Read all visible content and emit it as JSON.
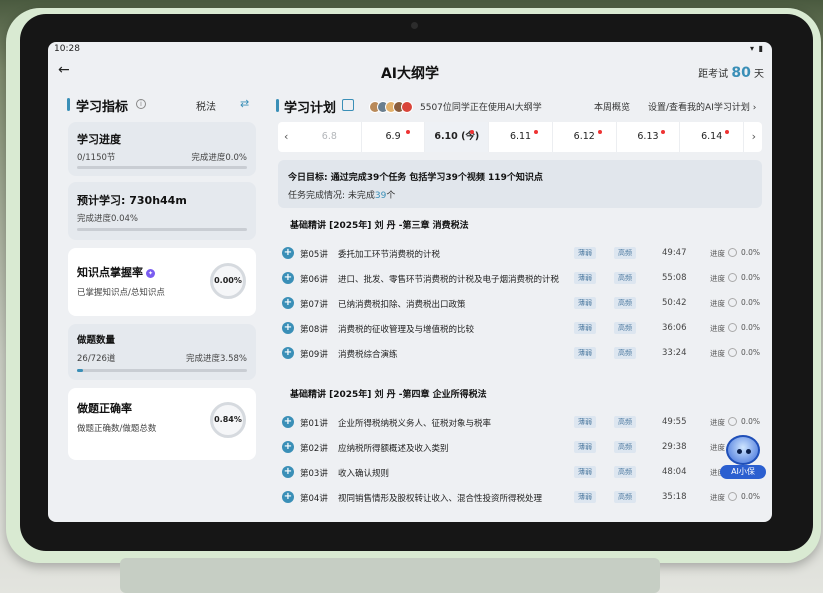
{
  "statusbar": {
    "time": "10:28",
    "sys_icons": "▾ ▮"
  },
  "header": {
    "back_icon": "←",
    "title": "AI大纲学",
    "exam_prefix": "距考试",
    "exam_days": "80",
    "exam_suffix": "天"
  },
  "left": {
    "title": "学习指标",
    "info_icon": "i",
    "subject": "税法",
    "switch_icon": "⇄",
    "progress": {
      "title": "学习进度",
      "done": "0/1150节",
      "rate": "完成进度0.0%",
      "fill_pct": 0
    },
    "forecast": {
      "title": "预计学习: 730h44m",
      "rate": "完成进度0.04%",
      "fill_pct": 0.04
    },
    "mastery": {
      "title": "知识点掌握率",
      "sub": "已掌握知识点/总知识点",
      "value": "0.00",
      "unit": "%"
    },
    "questions": {
      "title": "做题数量",
      "done": "26/726道",
      "rate": "完成进度3.58%",
      "fill_pct": 3.58
    },
    "accuracy": {
      "title": "做题正确率",
      "sub": "做题正确数/做题总数",
      "value": "0.84",
      "unit": "%"
    }
  },
  "plan": {
    "title": "学习计划",
    "users_text": "5507位同学正在使用AI大纲学",
    "week_link": "本周概览",
    "settings_link": "设置/查看我的AI学习计划",
    "prev_icon": "‹",
    "next_icon": "›",
    "dates": [
      {
        "label": "6.8",
        "state": "disabled",
        "dot": false
      },
      {
        "label": "6.9",
        "state": "normal",
        "dot": true
      },
      {
        "label": "6.10 (今)",
        "state": "active",
        "dot": true
      },
      {
        "label": "6.11",
        "state": "normal",
        "dot": true
      },
      {
        "label": "6.12",
        "state": "normal",
        "dot": true
      },
      {
        "label": "6.13",
        "state": "normal",
        "dot": true
      },
      {
        "label": "6.14",
        "state": "normal",
        "dot": true
      }
    ],
    "goal_line1": "今日目标: 通过完成39个任务 包括学习39个视频 119个知识点",
    "goal_line2_prefix": "任务完成情况: 未完成",
    "goal_line2_num": "39",
    "goal_line2_suffix": "个",
    "chapters": [
      {
        "title": "基础精讲  [2025年]  刘    丹  -第三章    消费税法",
        "lessons": [
          {
            "num": "第05讲",
            "name": "委托加工环节消费税的计税",
            "tag1": "薄弱",
            "tag2": "高频",
            "duration": "49:47",
            "progress_label": "进度",
            "progress": "0.0%"
          },
          {
            "num": "第06讲",
            "name": "进口、批发、零售环节消费税的计税及电子烟消费税的计税",
            "tag1": "薄弱",
            "tag2": "高频",
            "duration": "55:08",
            "progress_label": "进度",
            "progress": "0.0%"
          },
          {
            "num": "第07讲",
            "name": "已纳消费税扣除、消费税出口政策",
            "tag1": "薄弱",
            "tag2": "高频",
            "duration": "50:42",
            "progress_label": "进度",
            "progress": "0.0%"
          },
          {
            "num": "第08讲",
            "name": "消费税的征收管理及与增值税的比较",
            "tag1": "薄弱",
            "tag2": "高频",
            "duration": "36:06",
            "progress_label": "进度",
            "progress": "0.0%"
          },
          {
            "num": "第09讲",
            "name": "消费税综合演练",
            "tag1": "薄弱",
            "tag2": "高频",
            "duration": "33:24",
            "progress_label": "进度",
            "progress": "0.0%"
          }
        ]
      },
      {
        "title": "基础精讲  [2025年]  刘    丹  -第四章    企业所得税法",
        "lessons": [
          {
            "num": "第01讲",
            "name": "企业所得税纳税义务人、征税对象与税率",
            "tag1": "薄弱",
            "tag2": "高频",
            "duration": "49:55",
            "progress_label": "进度",
            "progress": "0.0%"
          },
          {
            "num": "第02讲",
            "name": "应纳税所得额概述及收入类别",
            "tag1": "薄弱",
            "tag2": "高频",
            "duration": "29:38",
            "progress_label": "进度",
            "progress": "0.0%"
          },
          {
            "num": "第03讲",
            "name": "收入确认规则",
            "tag1": "薄弱",
            "tag2": "高频",
            "duration": "48:04",
            "progress_label": "进度",
            "progress": "0.0%"
          },
          {
            "num": "第04讲",
            "name": "视同销售情形及股权转让收入、混合性投资所得税处理",
            "tag1": "薄弱",
            "tag2": "高频",
            "duration": "35:18",
            "progress_label": "进度",
            "progress": "0.0%"
          }
        ]
      }
    ]
  },
  "ai_bot": {
    "label": "AI小保"
  }
}
